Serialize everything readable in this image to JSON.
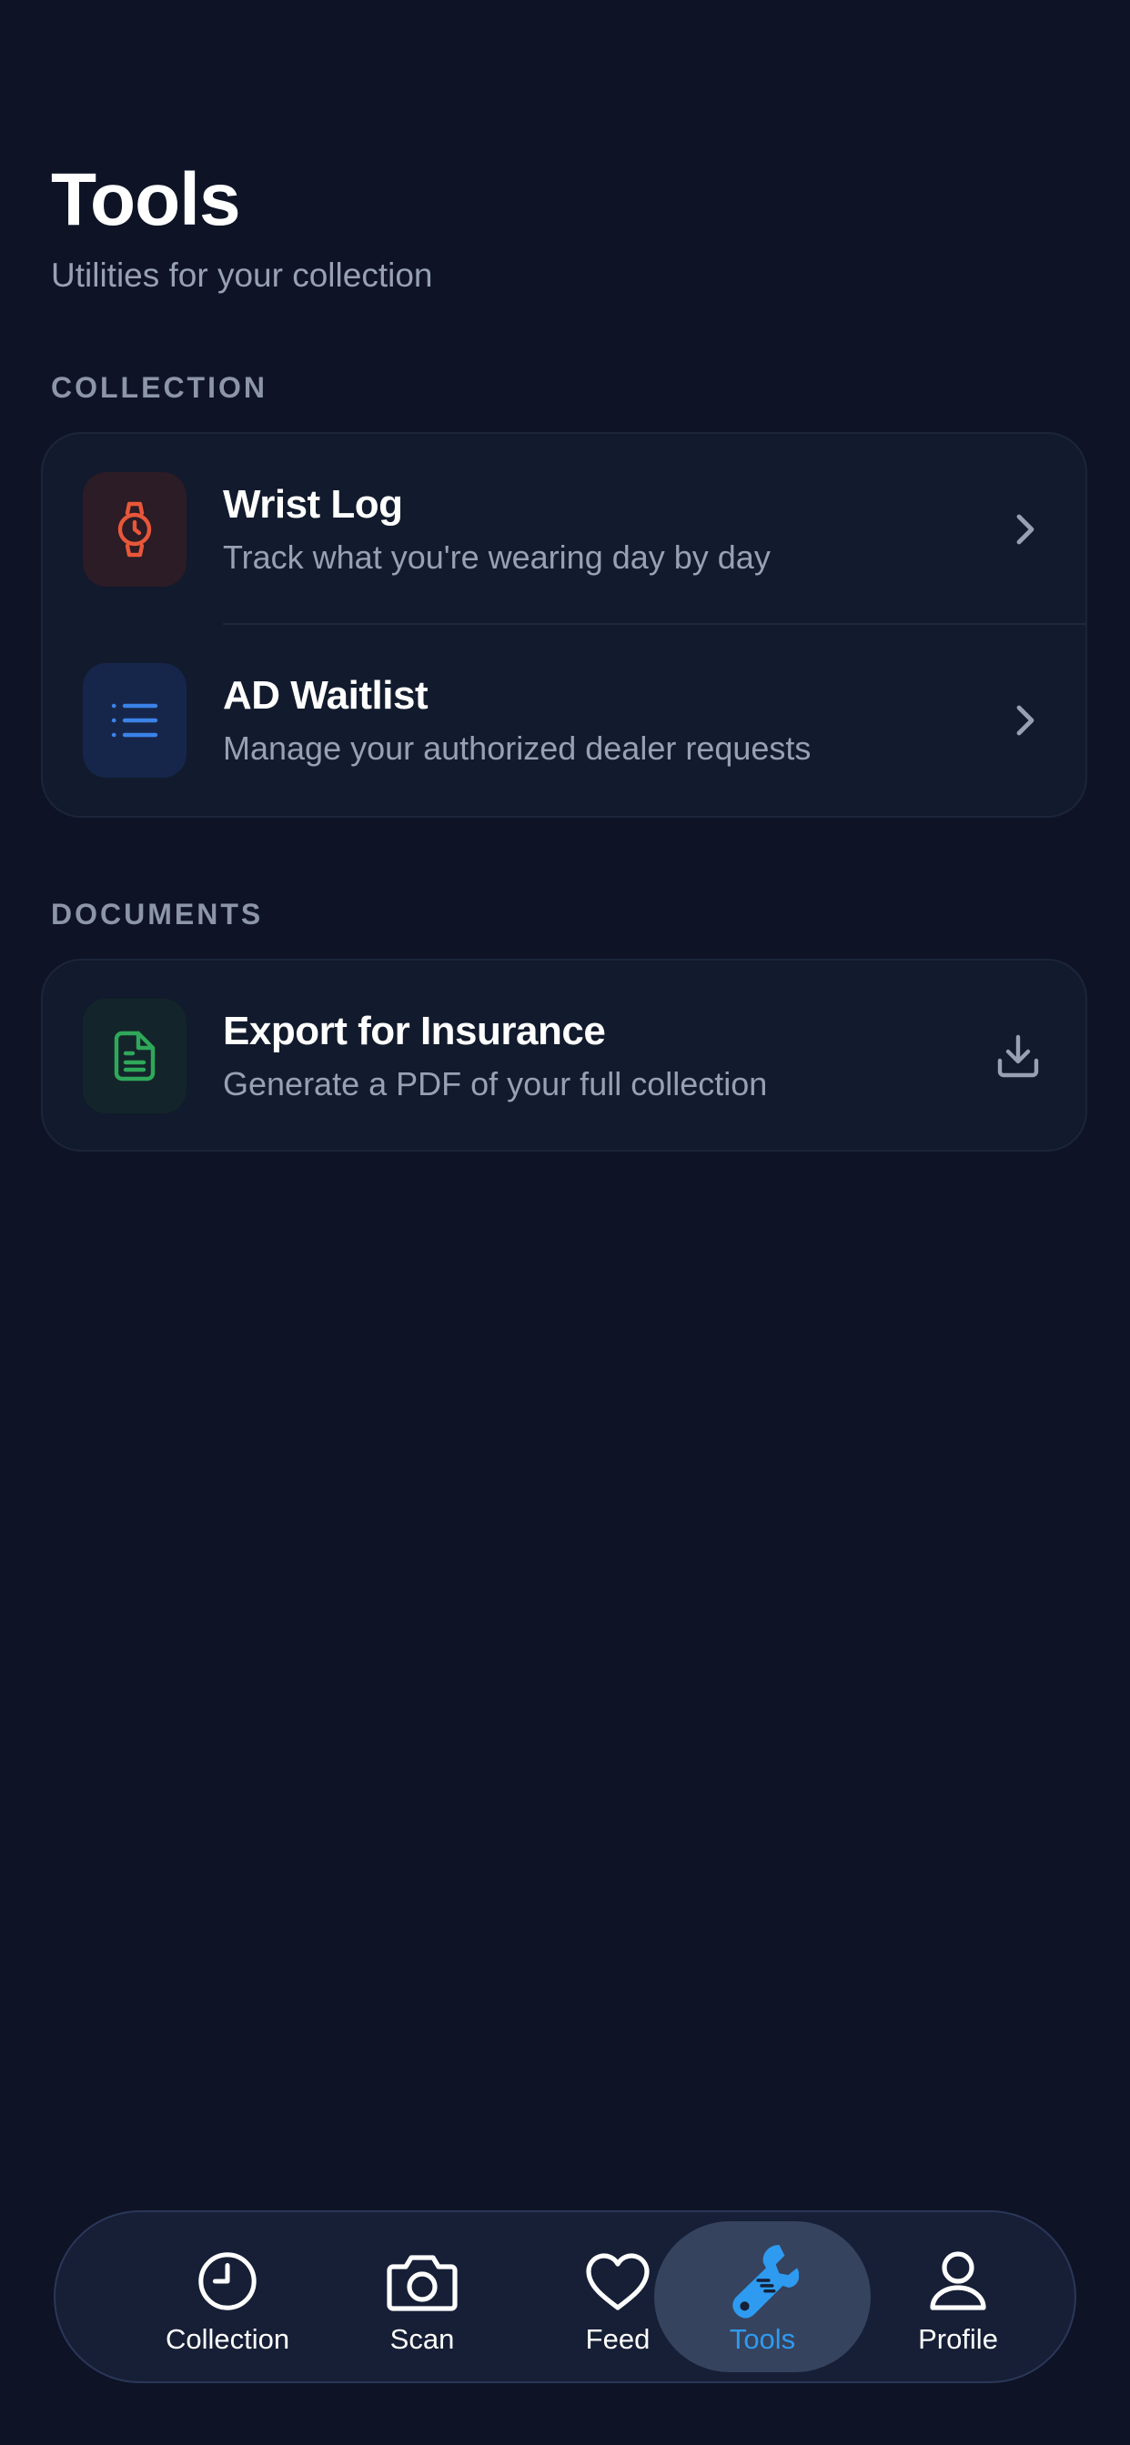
{
  "header": {
    "title": "Tools",
    "subtitle": "Utilities for your collection"
  },
  "sections": [
    {
      "label": "COLLECTION",
      "items": [
        {
          "title": "Wrist Log",
          "description": "Track what you're wearing day by day",
          "icon": "watch-icon",
          "icon_color": "#e8573a",
          "action_icon": "chevron-right-icon"
        },
        {
          "title": "AD Waitlist",
          "description": "Manage your authorized dealer requests",
          "icon": "list-icon",
          "icon_color": "#3b82e8",
          "action_icon": "chevron-right-icon"
        }
      ]
    },
    {
      "label": "DOCUMENTS",
      "items": [
        {
          "title": "Export for Insurance",
          "description": "Generate a PDF of your full collection",
          "icon": "document-icon",
          "icon_color": "#2fa85a",
          "action_icon": "download-icon"
        }
      ]
    }
  ],
  "tabbar": {
    "active": "Tools",
    "accent_color": "#2e9bf0",
    "tabs": [
      {
        "label": "Collection",
        "icon": "clock-icon"
      },
      {
        "label": "Scan",
        "icon": "camera-icon"
      },
      {
        "label": "Feed",
        "icon": "heart-icon"
      },
      {
        "label": "Tools",
        "icon": "wrench-icon"
      },
      {
        "label": "Profile",
        "icon": "person-icon"
      }
    ]
  },
  "colors": {
    "background": "#0e1426",
    "card": "#121a2d",
    "text_secondary": "#98a0b3"
  }
}
